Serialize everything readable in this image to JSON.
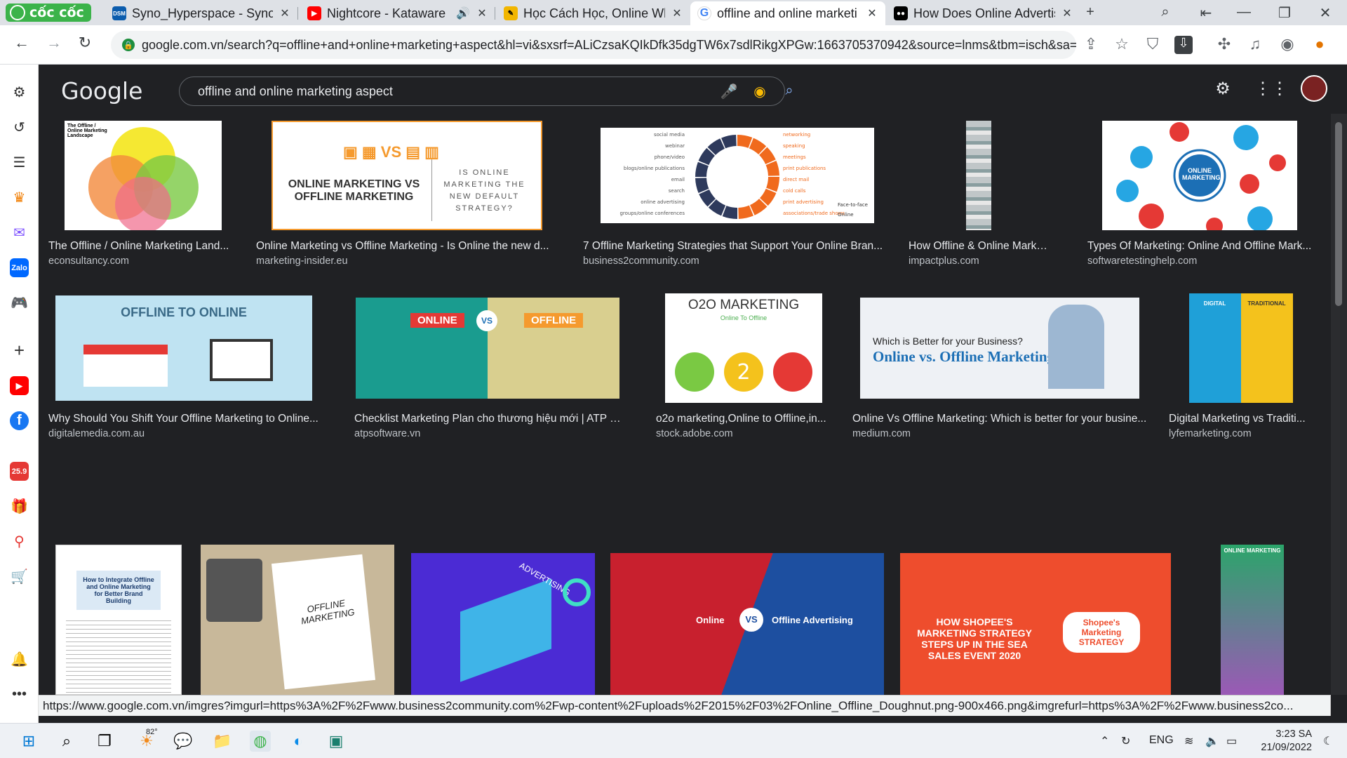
{
  "browser": {
    "brand": "cốc cốc",
    "tabs": [
      {
        "title": "Syno_Hyperspace - Synol",
        "fav": "DSM",
        "color": "#0b5cad"
      },
      {
        "title": "Nightcore - Kataware",
        "fav": "▶",
        "color": "#ff0000"
      },
      {
        "title": "Học Cách Học, Online Wh",
        "fav": "✎",
        "color": "#f2b600"
      },
      {
        "title": "offline and online marketi",
        "fav": "G",
        "color": "#4285f4"
      },
      {
        "title": "How Does Online Advertis",
        "fav": "●●",
        "color": "#000000"
      }
    ],
    "url": "google.com.vn/search?q=offline+and+online+marketing+aspect&hl=vi&sxsrf=ALiCzsaKQIkDfk35dgTW6x7sdlRikgXPGw:1663705370942&source=lnms&tbm=isch&sa=X..."
  },
  "google": {
    "logo": "Google",
    "query": "offline and online marketing aspect"
  },
  "results": [
    {
      "title": "The Offline / Online Marketing Land...",
      "source": "econsultancy.com",
      "img": "The Offline / Online Marketing Landscape"
    },
    {
      "title": "Online Marketing vs Offline Marketing - Is Online the new d...",
      "source": "marketing-insider.eu",
      "img": "ONLINE MARKETING VS OFFLINE MARKETING",
      "img2": "IS ONLINE MARKETING THE NEW DEFAULT STRATEGY?"
    },
    {
      "title": "7 Offline Marketing Strategies that Support Your Online Bran...",
      "source": "business2community.com",
      "img": ""
    },
    {
      "title": "How Offline & Online Marketin...",
      "source": "impactplus.com",
      "img": ""
    },
    {
      "title": "Types Of Marketing: Online And Offline Mark...",
      "source": "softwaretestinghelp.com",
      "img": "ONLINE MARKETING"
    },
    {
      "title": "Why Should You Shift Your Offline Marketing to Online...",
      "source": "digitalemedia.com.au",
      "img": "OFFLINE TO ONLINE"
    },
    {
      "title": "Checklist Marketing Plan cho thương hiệu mới | ATP Sof...",
      "source": "atpsoftware.vn",
      "img": "ONLINE",
      "img2": "OFFLINE"
    },
    {
      "title": "o2o marketing,Online to Offline,in...",
      "source": "stock.adobe.com",
      "img": "O2O MARKETING",
      "img2": "Online To Offline"
    },
    {
      "title": "Online Vs Offline Marketing: Which is better for your busine...",
      "source": "medium.com",
      "img": "Which is Better for your Business?",
      "img2": "Online vs. Offline Marketing"
    },
    {
      "title": "Digital Marketing vs Traditi...",
      "source": "lyfemarketing.com",
      "img": "DIGITAL",
      "img2": "TRADITIONAL"
    },
    {
      "title": "",
      "source": "",
      "img": "How to Integrate Offline and Online Marketing for Better Brand Building"
    },
    {
      "title": "",
      "source": "",
      "img": "OFFLINE MARKETING"
    },
    {
      "title": "",
      "source": "",
      "img": "ADVERTISING"
    },
    {
      "title": "",
      "source": "",
      "img": "Online",
      "img2": "Offline Advertising"
    },
    {
      "title": "",
      "source": "",
      "img": "HOW SHOPEE'S MARKETING STRATEGY STEPS UP IN THE SEA SALES EVENT 2020",
      "img2": "Shopee's Marketing STRATEGY"
    },
    {
      "title": "",
      "source": "",
      "img": "ONLINE MARKETING"
    }
  ],
  "donut": {
    "left": [
      "social media",
      "webinar",
      "phone/video",
      "blogs/online publications",
      "email",
      "search",
      "online advertising",
      "groups/online conferences"
    ],
    "right": [
      "networking",
      "speaking",
      "meetings",
      "print publications",
      "direct mail",
      "cold calls",
      "print advertising",
      "associations/trade shows"
    ],
    "legend": [
      "Face-to-face",
      "Online"
    ],
    "colors": {
      "online": "#2e3a5c",
      "offline": "#f06a1d"
    }
  },
  "status_url": "https://www.google.com.vn/imgres?imgurl=https%3A%2F%2Fwww.business2community.com%2Fwp-content%2Fuploads%2F2015%2F03%2FOnline_Offline_Doughnut.png-900x466.png&imgrefurl=https%3A%2F%2Fwww.business2co...",
  "taskbar": {
    "temp": "82°",
    "lang": "ENG",
    "time": "3:23 SA",
    "date": "21/09/2022"
  }
}
